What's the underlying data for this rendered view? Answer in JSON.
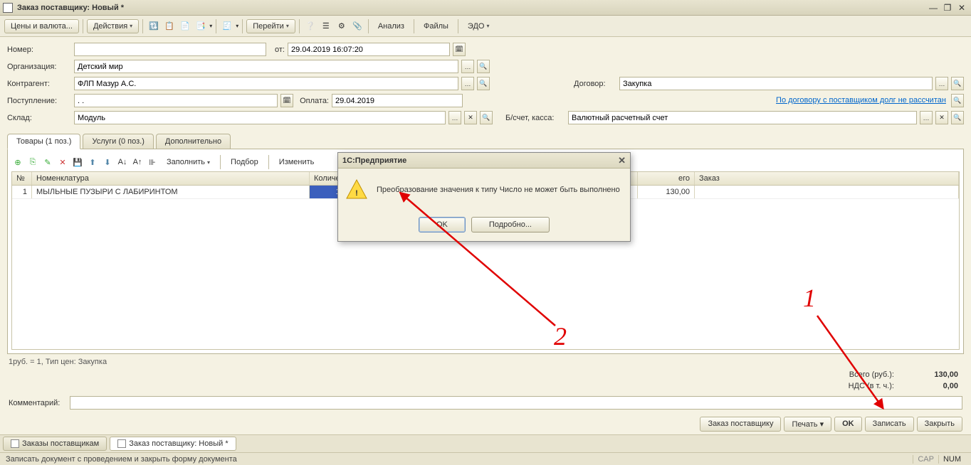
{
  "window": {
    "title": "Заказ поставщику: Новый *"
  },
  "toolbar": {
    "prices": "Цены и валюта...",
    "actions": "Действия",
    "goto": "Перейти",
    "analysis": "Анализ",
    "files": "Файлы",
    "edo": "ЭДО"
  },
  "form": {
    "number_label": "Номер:",
    "number": "",
    "date_label": "от:",
    "date": "29.04.2019 16:07:20",
    "org_label": "Организация:",
    "org": "Детский мир",
    "counter_label": "Контрагент:",
    "counter": "ФЛП Мазур А.С.",
    "contract_label": "Договор:",
    "contract": "Закупка",
    "receipt_label": "Поступление:",
    "receipt": ". .",
    "payment_label": "Оплата:",
    "payment": "29.04.2019",
    "debt_link": "По договору с поставщиком долг не рассчитан",
    "warehouse_label": "Склад:",
    "warehouse": "Модуль",
    "bank_label": "Б/счет, касса:",
    "bank": "Валютный расчетный счет"
  },
  "tabs": {
    "goods": "Товары (1 поз.)",
    "services": "Услуги (0 поз.)",
    "additional": "Дополнительно"
  },
  "gridbar": {
    "fill": "Заполнить",
    "select": "Подбор",
    "change": "Изменить"
  },
  "grid": {
    "cols": {
      "n": "№",
      "nom": "Номенклатура",
      "qty": "Количе",
      "sum": "его",
      "order": "Заказ"
    },
    "rows": [
      {
        "n": "1",
        "nom": "МЫЛЬНЫЕ ПУЗЫРИ С ЛАБИРИНТОМ",
        "qty": "13",
        "sum": "130,00",
        "order": ""
      }
    ]
  },
  "pricefooter": "1руб. = 1, Тип цен: Закупка",
  "totals": {
    "total_label": "Всего (руб.):",
    "total": "130,00",
    "vat_label": "НДС (в т. ч.):",
    "vat": "0,00"
  },
  "comment_label": "Комментарий:",
  "bottom": {
    "supplier_order": "Заказ поставщику",
    "print": "Печать",
    "ok": "OK",
    "save": "Записать",
    "close": "Закрыть"
  },
  "wintabs": {
    "list": "Заказы поставщикам",
    "doc": "Заказ поставщику: Новый *"
  },
  "status": {
    "hint": "Записать документ с проведением и закрыть форму документа",
    "cap": "CAP",
    "num": "NUM"
  },
  "modal": {
    "title": "1С:Предприятие",
    "message": "Преобразование значения к типу Число не может быть выполнено",
    "ok": "OK",
    "details": "Подробно..."
  },
  "annotations": {
    "one": "1",
    "two": "2"
  }
}
